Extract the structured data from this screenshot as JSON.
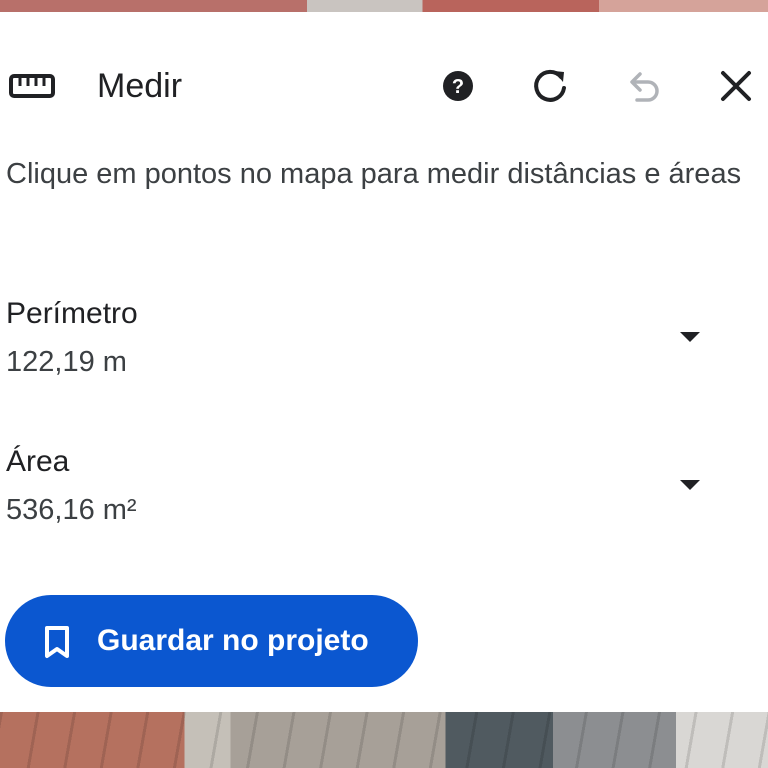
{
  "header": {
    "title": "Medir",
    "icons": {
      "measure": "ruler-icon",
      "help": "help-icon",
      "refresh": "refresh-icon",
      "undo": "undo-icon",
      "close": "close-icon"
    }
  },
  "instruction": "Clique em pontos no mapa para medir distâncias e áreas",
  "metrics": {
    "perimeter": {
      "label": "Perímetro",
      "value": "122,19 m"
    },
    "area": {
      "label": "Área",
      "value": "536,16 m²"
    }
  },
  "save": {
    "label": "Guardar no projeto",
    "icon": "bookmark-icon"
  },
  "colors": {
    "accent": "#0b57d0",
    "text_primary": "#202124",
    "text_secondary": "#3c4043",
    "icon_disabled": "#b0b3b8"
  }
}
